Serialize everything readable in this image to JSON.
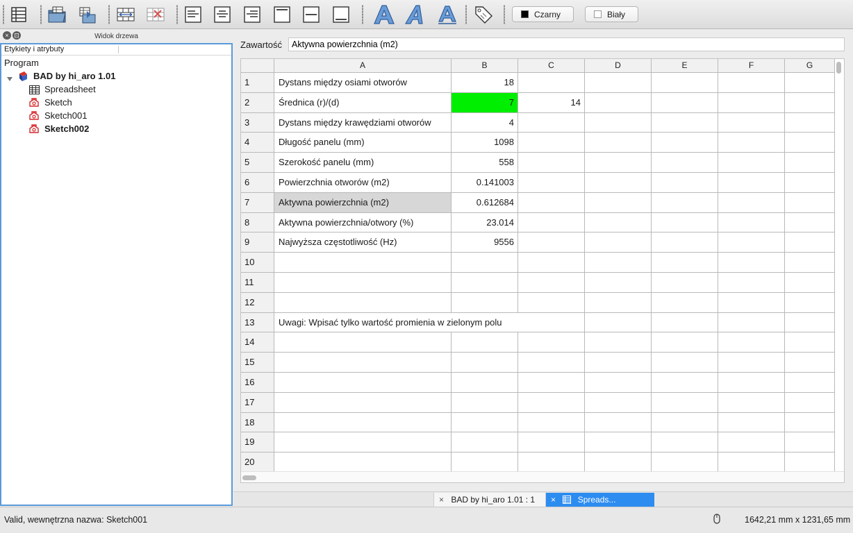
{
  "toolbar": {
    "icons": [
      "spreadsheet-icon",
      "import-icon",
      "export-icon",
      "merge-cells-icon",
      "split-cells-icon",
      "align-left-icon",
      "align-center-icon",
      "align-right-icon",
      "align-top-icon",
      "align-vcenter-icon",
      "align-bottom-icon",
      "bold-icon",
      "italic-icon",
      "underline-icon",
      "alias-tag-icon"
    ],
    "foreground_color": {
      "label": "Czarny",
      "swatch": "#000000"
    },
    "background_color": {
      "label": "Biały",
      "swatch": "#ffffff"
    }
  },
  "tree_panel": {
    "title": "Widok drzewa",
    "header": "Etykiety i atrybuty",
    "section": "Program",
    "document": "BAD by hi_aro 1.01",
    "items": [
      {
        "label": "Spreadsheet",
        "icon": "spreadsheet-icon",
        "bold": false
      },
      {
        "label": "Sketch",
        "icon": "sketch-icon",
        "bold": false
      },
      {
        "label": "Sketch001",
        "icon": "sketch-icon",
        "bold": false
      },
      {
        "label": "Sketch002",
        "icon": "sketch-icon",
        "bold": true
      }
    ],
    "accent_color": "#5a9ad8"
  },
  "content_bar": {
    "label": "Zawartość",
    "value": "Aktywna powierzchnia (m2)"
  },
  "sheet": {
    "columns": [
      "A",
      "B",
      "C",
      "D",
      "E",
      "F",
      "G"
    ],
    "rows": [
      {
        "n": "1",
        "A": "Dystans między osiami otworów",
        "B": "18",
        "C": ""
      },
      {
        "n": "2",
        "A": "Średnica (r)/(d)",
        "B": "7",
        "C": "14",
        "B_fill": "#00ee00"
      },
      {
        "n": "3",
        "A": "Dystans między krawędziami otworów",
        "B": "4",
        "C": ""
      },
      {
        "n": "4",
        "A": "Długość panelu (mm)",
        "B": "1098",
        "C": ""
      },
      {
        "n": "5",
        "A": "Szerokość panelu (mm)",
        "B": "558",
        "C": ""
      },
      {
        "n": "6",
        "A": "Powierzchnia otworów (m2)",
        "B": "0.141003",
        "C": ""
      },
      {
        "n": "7",
        "A": "Aktywna powierzchnia (m2)",
        "B": "0.612684",
        "C": "",
        "A_fill": "#d7d7d7"
      },
      {
        "n": "8",
        "A": "Aktywna powierzchnia/otwory (%)",
        "B": "23.014",
        "C": ""
      },
      {
        "n": "9",
        "A": "Najwyższa częstotliwość (Hz)",
        "B": "9556",
        "C": ""
      },
      {
        "n": "10",
        "A": "",
        "B": "",
        "C": ""
      },
      {
        "n": "11",
        "A": "",
        "B": "",
        "C": ""
      },
      {
        "n": "12",
        "A": "",
        "B": "",
        "C": ""
      },
      {
        "n": "13",
        "A": "Uwagi: Wpisać tylko wartość promienia w zielonym polu",
        "B": "",
        "C": "",
        "span": true
      },
      {
        "n": "14",
        "A": "",
        "B": "",
        "C": ""
      },
      {
        "n": "15",
        "A": "",
        "B": "",
        "C": ""
      },
      {
        "n": "16",
        "A": "",
        "B": "",
        "C": ""
      },
      {
        "n": "17",
        "A": "",
        "B": "",
        "C": ""
      },
      {
        "n": "18",
        "A": "",
        "B": "",
        "C": ""
      },
      {
        "n": "19",
        "A": "",
        "B": "",
        "C": ""
      },
      {
        "n": "20",
        "A": "",
        "B": "",
        "C": ""
      }
    ]
  },
  "tabs": [
    {
      "label": "BAD by hi_aro 1.01 : 1",
      "close": "×",
      "active": false
    },
    {
      "label": "Spreads...",
      "close": "×",
      "active": true,
      "color": "#2d8cf0"
    }
  ],
  "status": {
    "text": "Valid, wewnętrzna nazwa: Sketch001",
    "dimensions": "1642,21 mm x 1231,65 mm"
  }
}
